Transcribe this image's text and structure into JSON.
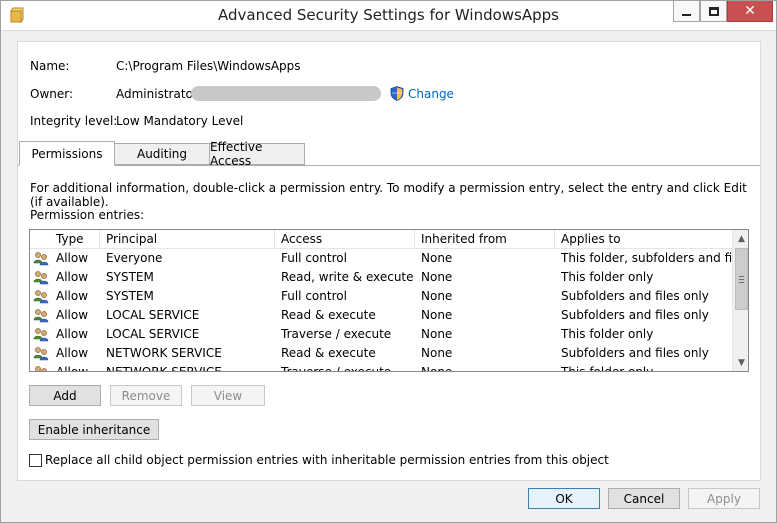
{
  "window": {
    "title": "Advanced Security Settings for WindowsApps",
    "close_glyph": "✕"
  },
  "info": {
    "name_label": "Name:",
    "name_value": "C:\\Program Files\\WindowsApps",
    "owner_label": "Owner:",
    "owner_value": "Administrator",
    "change_link": "Change",
    "integrity_label": "Integrity level:",
    "integrity_value": "Low Mandatory Level"
  },
  "tabs": [
    {
      "label": "Permissions",
      "active": true
    },
    {
      "label": "Auditing",
      "active": false
    },
    {
      "label": "Effective Access",
      "active": false
    }
  ],
  "permissions": {
    "help_text": "For additional information, double-click a permission entry. To modify a permission entry, select the entry and click Edit (if available).",
    "entries_label": "Permission entries:",
    "columns": [
      "Type",
      "Principal",
      "Access",
      "Inherited from",
      "Applies to"
    ],
    "rows": [
      [
        "Allow",
        "Everyone",
        "Full control",
        "None",
        "This folder, subfolders and files"
      ],
      [
        "Allow",
        "SYSTEM",
        "Read, write & execute",
        "None",
        "This folder only"
      ],
      [
        "Allow",
        "SYSTEM",
        "Full control",
        "None",
        "Subfolders and files only"
      ],
      [
        "Allow",
        "LOCAL SERVICE",
        "Read & execute",
        "None",
        "Subfolders and files only"
      ],
      [
        "Allow",
        "LOCAL SERVICE",
        "Traverse / execute",
        "None",
        "This folder only"
      ],
      [
        "Allow",
        "NETWORK SERVICE",
        "Read & execute",
        "None",
        "Subfolders and files only"
      ],
      [
        "Allow",
        "NETWORK SERVICE",
        "Traverse / execute",
        "None",
        "This folder only"
      ]
    ],
    "scroll_up": "▲",
    "scroll_down": "▼",
    "add_label": "Add",
    "remove_label": "Remove",
    "view_label": "View",
    "enable_inheritance_label": "Enable inheritance",
    "replace_label": "Replace all child object permission entries with inheritable permission entries from this object",
    "replace_checked": false
  },
  "footer": {
    "ok_label": "OK",
    "cancel_label": "Cancel",
    "apply_label": "Apply"
  },
  "colors": {
    "close_button": "#c75050",
    "link": "#0066cc",
    "window_bg": "#f0f0f0"
  },
  "icons": {
    "title": "folder-icon",
    "change": "uac-shield-icon",
    "row": "user-group-icon"
  }
}
